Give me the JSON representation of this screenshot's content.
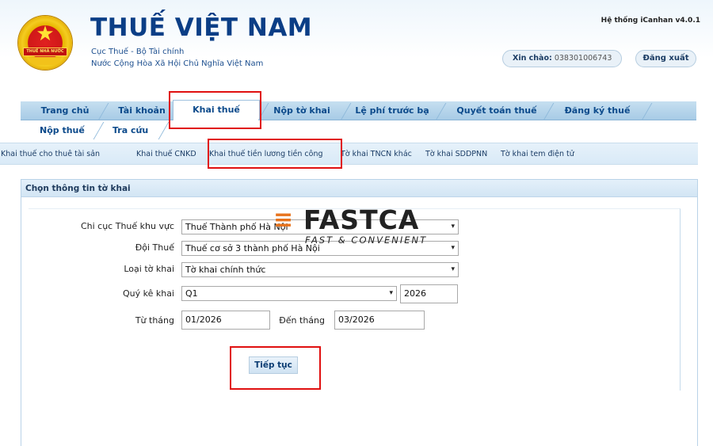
{
  "header": {
    "emblem_text": "THUẾ NHÀ NƯỚC",
    "title": "THUẾ VIỆT NAM",
    "subtitle1": "Cục Thuế - Bộ Tài chính",
    "subtitle2": "Nước Cộng Hòa Xã Hội Chủ Nghĩa Việt Nam",
    "system_version": "Hệ thống iCanhan v4.0.1",
    "greeting_label": "Xin chào:",
    "greeting_user": "038301006743",
    "logout_label": "Đăng xuất"
  },
  "main_nav": {
    "items": [
      {
        "label": "Trang chủ"
      },
      {
        "label": "Tài khoản"
      },
      {
        "label": "Khai thuế"
      },
      {
        "label": "Nộp tờ khai"
      },
      {
        "label": "Lệ phí trước bạ"
      },
      {
        "label": "Quyết toán thuế"
      },
      {
        "label": "Đăng ký thuế"
      }
    ],
    "active": "Khai thuế"
  },
  "sub_nav": {
    "items": [
      {
        "label": "Nộp thuế"
      },
      {
        "label": "Tra cứu"
      }
    ]
  },
  "third_nav": {
    "items": [
      {
        "label": "Khai thuế cho thuê tài sản"
      },
      {
        "label": "Khai thuế CNKD"
      },
      {
        "label": "Khai thuế tiền lương tiền công"
      },
      {
        "label": "Tờ khai TNCN khác"
      },
      {
        "label": "Tờ khai SDDPNN"
      },
      {
        "label": "Tờ khai tem điện tử"
      }
    ],
    "selected": "Khai thuế tiền lương tiền công"
  },
  "panel": {
    "title": "Chọn thông tin tờ khai"
  },
  "form": {
    "chi_cuc_label": "Chi cục Thuế khu vực",
    "chi_cuc_value": "Thuế Thành phố Hà Nội",
    "doi_thue_label": "Đội Thuế",
    "doi_thue_value": "Thuế cơ sở 3 thành phố Hà Nội",
    "loai_to_khai_label": "Loại tờ khai",
    "loai_to_khai_value": "Tờ khai chính thức",
    "quy_ke_khai_label": "Quý kê khai",
    "quy_ke_khai_value": "Q1",
    "year_value": "2026",
    "tu_thang_label": "Từ tháng",
    "tu_thang_value": "01/2026",
    "den_thang_label": "Đến tháng",
    "den_thang_value": "03/2026",
    "submit_label": "Tiếp tục"
  },
  "watermark": {
    "brand": "FASTCA",
    "tagline": "FAST & CONVENIENT"
  },
  "colors": {
    "brand_blue": "#0b3e86",
    "nav_bg": "#a7cbe6",
    "highlight_red": "#e01010",
    "watermark_orange": "#e8731c"
  }
}
